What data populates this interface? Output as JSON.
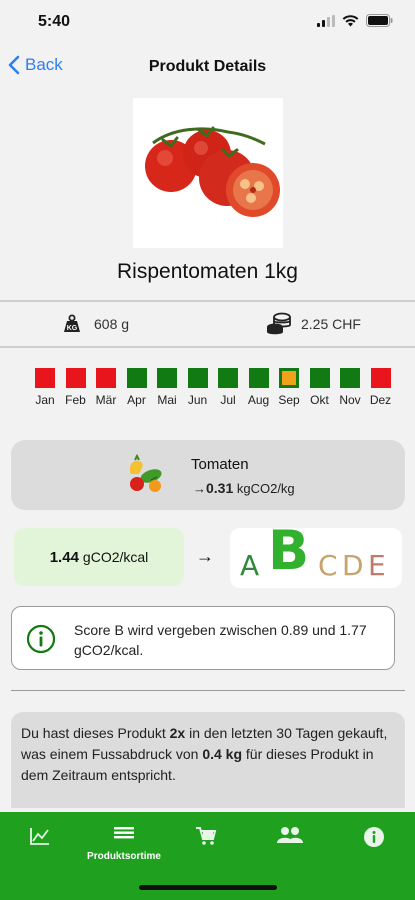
{
  "status": {
    "time": "5:40"
  },
  "nav": {
    "back_label": "Back",
    "title": "Produkt Details"
  },
  "product": {
    "name": "Rispentomaten 1kg",
    "weight": "608 g",
    "price": "2.25 CHF"
  },
  "season": {
    "months": [
      {
        "label": "Jan",
        "status": "red"
      },
      {
        "label": "Feb",
        "status": "red"
      },
      {
        "label": "Mär",
        "status": "red"
      },
      {
        "label": "Apr",
        "status": "green"
      },
      {
        "label": "Mai",
        "status": "green"
      },
      {
        "label": "Jun",
        "status": "green"
      },
      {
        "label": "Jul",
        "status": "green"
      },
      {
        "label": "Aug",
        "status": "green"
      },
      {
        "label": "Sep",
        "status": "current"
      },
      {
        "label": "Okt",
        "status": "green"
      },
      {
        "label": "Nov",
        "status": "green"
      },
      {
        "label": "Dez",
        "status": "red"
      }
    ],
    "colors": {
      "red": "#e8161c",
      "green": "#127a12",
      "current_fill": "#f0a21b",
      "current_border": "#127a12"
    }
  },
  "category": {
    "name": "Tomaten",
    "arrow": "→",
    "value": "0.31",
    "unit": " kgCO2/kg"
  },
  "kcal": {
    "value": "1.44",
    "unit": "gCO2/kcal"
  },
  "arrow_symbol": "→",
  "score": {
    "letters": [
      {
        "letter": "A",
        "color": "#2e8a3a",
        "size": 28
      },
      {
        "letter": "B",
        "color": "#32b12e",
        "size": 54
      },
      {
        "letter": "C",
        "color": "#c6a46a",
        "size": 28
      },
      {
        "letter": "D",
        "color": "#c6a46a",
        "size": 28
      },
      {
        "letter": "E",
        "color": "#c07a6a",
        "size": 28
      }
    ]
  },
  "note": {
    "text": "Score B wird vergeben zwischen 0.89 und 1.77 gCO2/kcal."
  },
  "purchase": {
    "t1": "Du hast dieses Produkt ",
    "count": "2x",
    "t2": " in den letzten 30 Tagen gekauft, was einem Fussabdruck von ",
    "amount": "0.4 kg",
    "t3": " für dieses Produkt in dem Zeitraum entspricht."
  },
  "tabs": [
    {
      "label": "",
      "icon": "chart-icon"
    },
    {
      "label": "Produktsortime",
      "icon": "list-icon"
    },
    {
      "label": "",
      "icon": "cart-icon"
    },
    {
      "label": "",
      "icon": "people-icon"
    },
    {
      "label": "",
      "icon": "info-icon"
    }
  ]
}
